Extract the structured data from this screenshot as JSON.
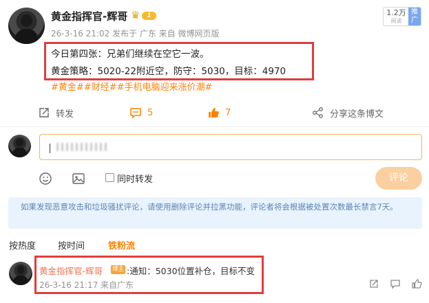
{
  "post": {
    "author": "黄金指挥官-辉哥",
    "level_badge": "1",
    "meta": "26-3-16 21:02 发布于 广东  来自 微博网页版",
    "follower_count": "1.2万",
    "follower_label": "阅读",
    "follow_button": "推广",
    "content_line1": "今日第四张：兄弟们继续在空它一波。",
    "content_line2": "黄金策略：5020-22附近空，防守：5030，目标：4970",
    "tags": "#黄金##财经##手机电脑迎来涨价潮#"
  },
  "actions": {
    "repost_label": "转发",
    "comment_count": "5",
    "like_count": "7",
    "share_label": "分享这条博文"
  },
  "reply_form": {
    "sync_repost_label": "同时转发",
    "submit_label": "评论"
  },
  "notice": "如果发现恶意攻击和垃圾骚扰评论，请使用删除评论并拉黑功能，评论者将会根据被处置次数最长禁言7天。",
  "sort_tabs": [
    "按热度",
    "按时间",
    "铁粉流"
  ],
  "comment": {
    "user": "黄金指挥官-辉哥",
    "badge": "博主",
    "text": ":通知：5030位置补仓，目标不变",
    "meta": "26-3-16 21:17 来自广东"
  },
  "colors": {
    "accent_orange": "#ff8200",
    "highlight_red": "#e23c3c",
    "notice_bg": "#e9f3fd",
    "notice_text": "#5d84b6"
  }
}
